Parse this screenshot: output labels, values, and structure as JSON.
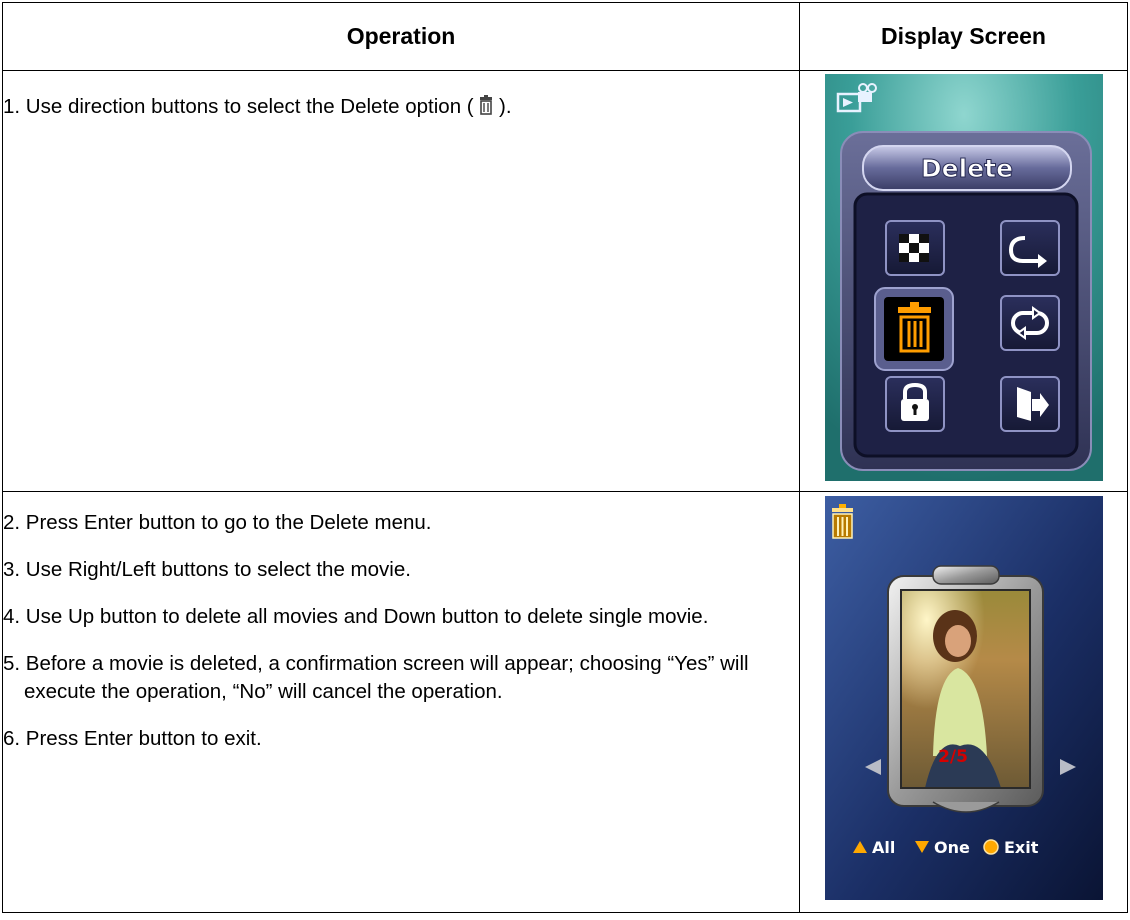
{
  "header": {
    "operation": "Operation",
    "display_screen": "Display Screen"
  },
  "row1": {
    "step_prefix": "1. Use direction buttons to select the Delete option ( ",
    "step_suffix": " ).",
    "screen": {
      "menu_title": "Delete",
      "icons": [
        "thumbnail-icon",
        "repeat-one-icon",
        "trash-icon",
        "repeat-all-icon",
        "lock-icon",
        "exit-icon"
      ],
      "selected": "trash-icon"
    }
  },
  "row2": {
    "steps": [
      "2. Press Enter button to go to the Delete menu.",
      "3. Use Right/Left buttons to select the movie.",
      "4. Use Up button to delete all movies and Down button to delete single movie.",
      "5. Before a movie is deleted, a confirmation screen will appear; choosing “Yes” will execute the operation, “No” will cancel the operation.",
      "6. Press Enter button to exit."
    ],
    "screen": {
      "counter": "2/5",
      "all_label": "All",
      "one_label": "One",
      "exit_label": "Exit"
    }
  },
  "colors": {
    "teal_bg": "#2f8f8a",
    "menu_frame": "#4a4e74",
    "selected": "#ff9d00",
    "dark_blue": "#12224f"
  }
}
